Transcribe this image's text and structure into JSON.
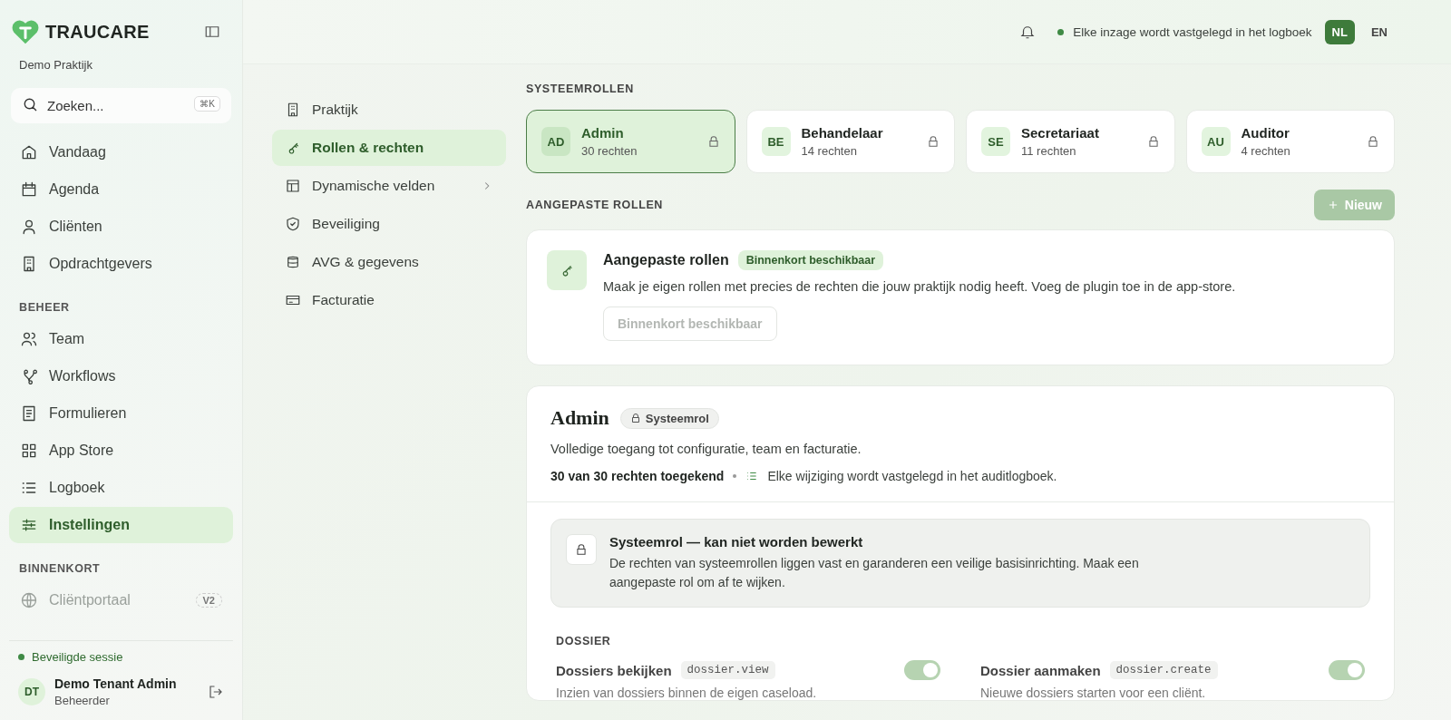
{
  "brand": {
    "name": "TRAUCARE",
    "tenant": "Demo Praktijk"
  },
  "search": {
    "placeholder": "Zoeken...",
    "shortcut": "⌘K"
  },
  "nav_sections": [
    {
      "items": [
        {
          "label": "Vandaag",
          "selected": false
        },
        {
          "label": "Agenda",
          "selected": false
        },
        {
          "label": "Cliënten",
          "selected": false
        },
        {
          "label": "Opdrachtgevers",
          "selected": false
        }
      ]
    },
    {
      "heading": "BEHEER",
      "items": [
        {
          "label": "Team",
          "selected": false
        },
        {
          "label": "Workflows",
          "selected": false
        },
        {
          "label": "Formulieren",
          "selected": false
        },
        {
          "label": "App Store",
          "selected": false
        },
        {
          "label": "Logboek",
          "selected": false
        },
        {
          "label": "Instellingen",
          "selected": true
        }
      ]
    },
    {
      "heading": "BINNENKORT",
      "items": [
        {
          "label": "Cliëntportaal",
          "selected": false,
          "badge": "V2"
        }
      ]
    }
  ],
  "session": {
    "label": "Beveiligde sessie"
  },
  "user": {
    "initials": "DT",
    "name": "Demo Tenant Admin",
    "role": "Beheerder"
  },
  "topbar": {
    "notice": "Elke inzage wordt vastgelegd in het logboek",
    "languages": [
      {
        "label": "NL",
        "selected": true
      },
      {
        "label": "EN",
        "selected": false
      }
    ]
  },
  "settings_nav": [
    {
      "label": "Praktijk",
      "selected": false,
      "submenu": false
    },
    {
      "label": "Rollen & rechten",
      "selected": true,
      "submenu": false
    },
    {
      "label": "Dynamische velden",
      "selected": false,
      "submenu": true
    },
    {
      "label": "Beveiliging",
      "selected": false,
      "submenu": false
    },
    {
      "label": "AVG & gegevens",
      "selected": false,
      "submenu": false
    },
    {
      "label": "Facturatie",
      "selected": false,
      "submenu": false
    }
  ],
  "system_roles": {
    "heading": "SYSTEEMROLLEN",
    "roles": [
      {
        "initials": "AD",
        "name": "Admin",
        "count": "30 rechten",
        "selected": true
      },
      {
        "initials": "BE",
        "name": "Behandelaar",
        "count": "14 rechten",
        "selected": false
      },
      {
        "initials": "SE",
        "name": "Secretariaat",
        "count": "11 rechten",
        "selected": false
      },
      {
        "initials": "AU",
        "name": "Auditor",
        "count": "4 rechten",
        "selected": false
      }
    ]
  },
  "custom_roles": {
    "heading": "AANGEPASTE ROLLEN",
    "new_button": {
      "label": "Nieuw",
      "disabled": true
    },
    "card": {
      "title": "Aangepaste rollen",
      "badge": "Binnenkort beschikbaar",
      "description": "Maak je eigen rollen met precies de rechten die jouw praktijk nodig heeft. Voeg de plugin toe in de app-store.",
      "button": {
        "label": "Binnenkort beschikbaar",
        "disabled": true
      }
    }
  },
  "role_detail": {
    "title": "Admin",
    "badge": "Systeemrol",
    "description": "Volledige toegang tot configuratie, team en facturatie.",
    "granted": "30 van 30 rechten toegekend",
    "audit_note": "Elke wijziging wordt vastgelegd in het auditlogboek.",
    "notice": {
      "title": "Systeemrol — kan niet worden bewerkt",
      "text": "De rechten van systeemrollen liggen vast en garanderen een veilige basisinrichting. Maak een aangepaste rol om af te wijken."
    },
    "groups": [
      {
        "heading": "DOSSIER",
        "permissions": [
          {
            "label": "Dossiers bekijken",
            "code": "dossier.view",
            "description": "Inzien van dossiers binnen de eigen caseload.",
            "on": true
          },
          {
            "label": "Dossier aanmaken",
            "code": "dossier.create",
            "description": "Nieuwe dossiers starten voor een cliënt.",
            "on": true
          }
        ]
      }
    ]
  }
}
